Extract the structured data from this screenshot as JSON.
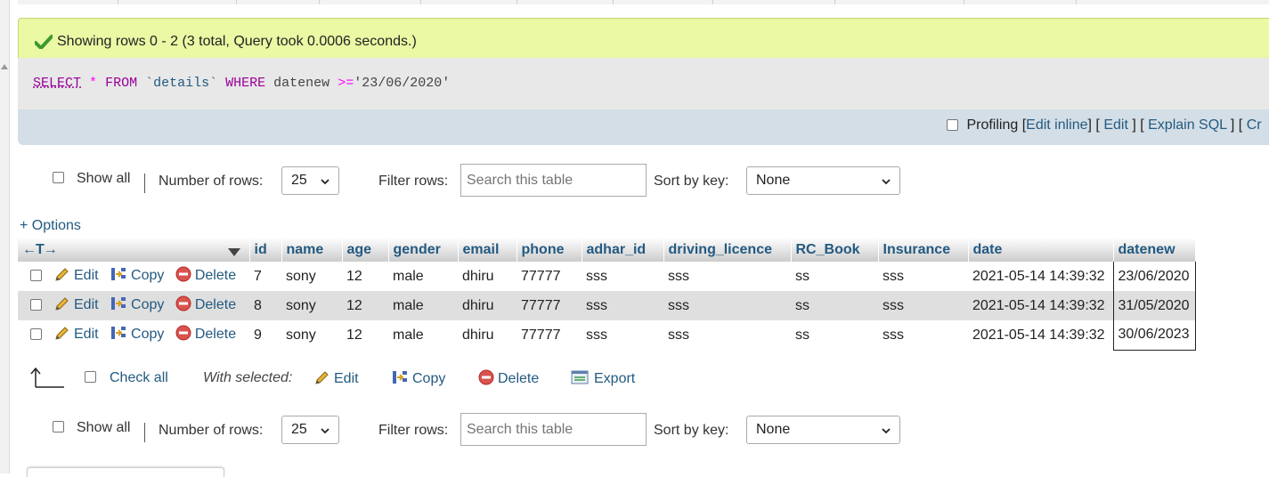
{
  "message": "Showing rows 0 - 2 (3 total, Query took 0.0006 seconds.)",
  "sql": {
    "select": "SELECT",
    "star": "*",
    "from": "FROM",
    "table": "`details`",
    "where": "WHERE",
    "field": "datenew",
    "op": ">=",
    "value": "'23/06/2020'"
  },
  "actions_bar": {
    "profiling": "Profiling",
    "edit_inline": "Edit inline",
    "edit": "Edit",
    "explain_sql": "Explain SQL",
    "create_php": "Cr"
  },
  "nav": {
    "show_all": "Show all",
    "number_of_rows_label": "Number of rows:",
    "rows_value": "25",
    "filter_label": "Filter rows:",
    "search_placeholder": "Search this table",
    "sort_label": "Sort by key:",
    "sort_value": "None"
  },
  "options_link": "+ Options",
  "table": {
    "columns": [
      "id",
      "name",
      "age",
      "gender",
      "email",
      "phone",
      "adhar_id",
      "driving_licence",
      "RC_Book",
      "Insurance",
      "date",
      "datenew"
    ],
    "row_actions": {
      "edit": "Edit",
      "copy": "Copy",
      "delete": "Delete"
    },
    "rows": [
      [
        "7",
        "sony",
        "12",
        "male",
        "dhiru",
        "77777",
        "sss",
        "sss",
        "ss",
        "sss",
        "2021-05-14 14:39:32",
        "23/06/2020"
      ],
      [
        "8",
        "sony",
        "12",
        "male",
        "dhiru",
        "77777",
        "sss",
        "sss",
        "ss",
        "sss",
        "2021-05-14 14:39:32",
        "31/05/2020"
      ],
      [
        "9",
        "sony",
        "12",
        "male",
        "dhiru",
        "77777",
        "sss",
        "sss",
        "ss",
        "sss",
        "2021-05-14 14:39:32",
        "30/06/2023"
      ]
    ]
  },
  "bulk": {
    "check_all": "Check all",
    "with_selected": "With selected:",
    "edit": "Edit",
    "copy": "Copy",
    "delete": "Delete",
    "export": "Export"
  },
  "colors": {
    "link": "#235a81",
    "success_bg": "#ebf8a4",
    "sql_bg": "#e8e8e8",
    "actions_bg": "#d4dee6",
    "row_alt": "#dfdfdf"
  }
}
